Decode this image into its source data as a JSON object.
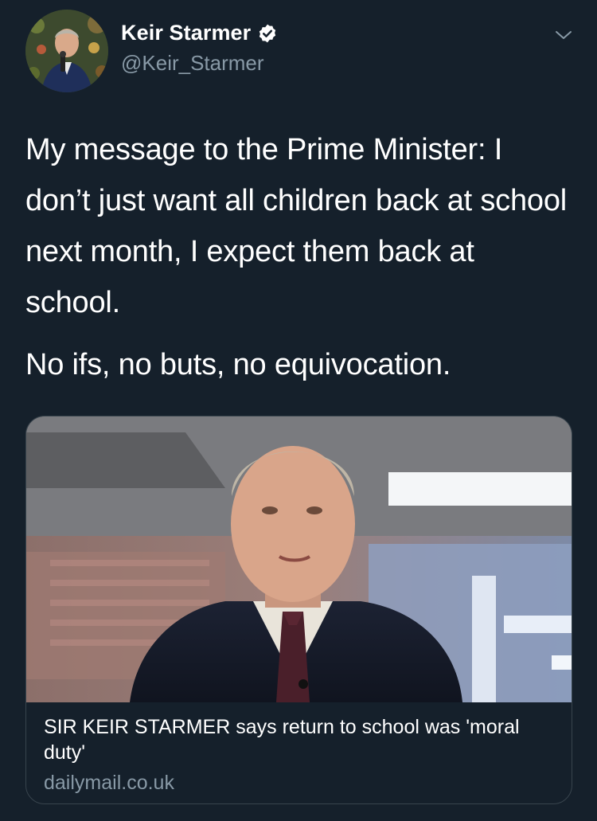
{
  "author": {
    "display_name": "Keir Starmer",
    "handle": "@Keir_Starmer",
    "verified": true,
    "avatar_icon": "profile-photo"
  },
  "tweet": {
    "paragraphs": [
      "My message to the Prime Minister: I don’t just want all children back at school next month, I expect them back at school.",
      "No ifs, no buts, no equivocation."
    ]
  },
  "link_card": {
    "title": "SIR KEIR STARMER says return to school was 'moral duty'",
    "domain": "dailymail.co.uk",
    "image_icon": "article-photo"
  },
  "colors": {
    "background": "#15202b",
    "text": "#ffffff",
    "secondary_text": "#8899a6",
    "border": "#38444d",
    "verified_badge": "#ffffff"
  },
  "icons": {
    "verified": "verified-badge-icon",
    "menu": "chevron-down-icon"
  }
}
